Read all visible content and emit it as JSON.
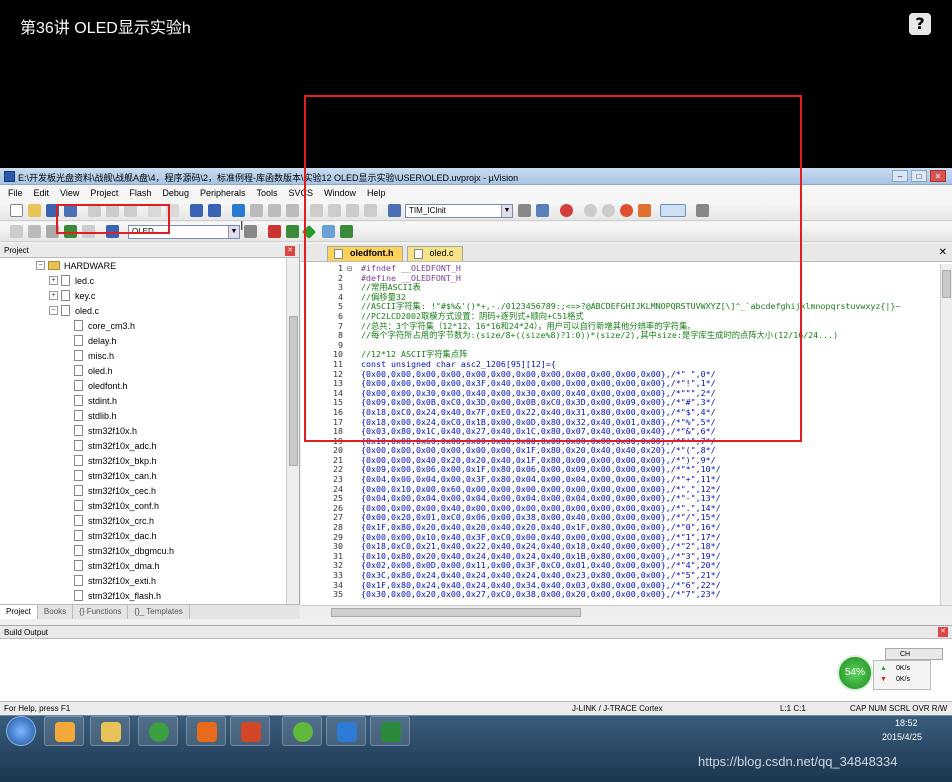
{
  "video": {
    "title": "第36讲 OLED显示实验h",
    "help_icon": "question-icon"
  },
  "window": {
    "title": "E:\\开发板光盘资料\\战舰\\战舰A盘\\4，程序源码\\2，标准例程-库函数版本\\实验12 OLED显示实验\\USER\\OLED.uvprojx - µVision"
  },
  "menu": [
    "File",
    "Edit",
    "View",
    "Project",
    "Flash",
    "Debug",
    "Peripherals",
    "Tools",
    "SVCS",
    "Window",
    "Help"
  ],
  "toolbar": {
    "function_combo": "TIM_ICInit",
    "target_combo": "OLED"
  },
  "project_panel": {
    "title": "Project",
    "tree": [
      {
        "label": "HARDWARE",
        "level": 0,
        "kind": "folder",
        "exp": "−"
      },
      {
        "label": "led.c",
        "level": 1,
        "kind": "file",
        "exp": "+"
      },
      {
        "label": "key.c",
        "level": 1,
        "kind": "file",
        "exp": "+"
      },
      {
        "label": "oled.c",
        "level": 1,
        "kind": "file",
        "exp": "−"
      },
      {
        "label": "core_cm3.h",
        "level": 2,
        "kind": "file"
      },
      {
        "label": "delay.h",
        "level": 2,
        "kind": "file"
      },
      {
        "label": "misc.h",
        "level": 2,
        "kind": "file"
      },
      {
        "label": "oled.h",
        "level": 2,
        "kind": "file"
      },
      {
        "label": "oledfont.h",
        "level": 2,
        "kind": "file"
      },
      {
        "label": "stdint.h",
        "level": 2,
        "kind": "file"
      },
      {
        "label": "stdlib.h",
        "level": 2,
        "kind": "file"
      },
      {
        "label": "stm32f10x.h",
        "level": 2,
        "kind": "file"
      },
      {
        "label": "stm32f10x_adc.h",
        "level": 2,
        "kind": "file"
      },
      {
        "label": "stm32f10x_bkp.h",
        "level": 2,
        "kind": "file"
      },
      {
        "label": "stm32f10x_can.h",
        "level": 2,
        "kind": "file"
      },
      {
        "label": "stm32f10x_cec.h",
        "level": 2,
        "kind": "file"
      },
      {
        "label": "stm32f10x_conf.h",
        "level": 2,
        "kind": "file"
      },
      {
        "label": "stm32f10x_crc.h",
        "level": 2,
        "kind": "file"
      },
      {
        "label": "stm32f10x_dac.h",
        "level": 2,
        "kind": "file"
      },
      {
        "label": "stm32f10x_dbgmcu.h",
        "level": 2,
        "kind": "file"
      },
      {
        "label": "stm32f10x_dma.h",
        "level": 2,
        "kind": "file"
      },
      {
        "label": "stm32f10x_exti.h",
        "level": 2,
        "kind": "file"
      },
      {
        "label": "stm32f10x_flash.h",
        "level": 2,
        "kind": "file"
      }
    ],
    "tabs": [
      "Project",
      "Books",
      "{} Functions",
      "{}_ Templates"
    ]
  },
  "editor": {
    "tabs": [
      "oledfont.h",
      "oled.c"
    ],
    "lines": [
      [
        "1",
        "⊟",
        "#ifndef __OLEDFONT_H",
        "pp"
      ],
      [
        "2",
        "",
        "#define __OLEDFONT_H",
        "pp"
      ],
      [
        "3",
        "",
        "//常用ASCII表",
        "cm"
      ],
      [
        "4",
        "",
        "//偏移量32",
        "cm"
      ],
      [
        "5",
        "",
        "//ASCII字符集: !\"#$%&'()*+,-./0123456789:;<=>?@ABCDEFGHIJKLMNOPQRSTUVWXYZ[\\]^_`abcdefghijklmnopqrstuvwxyz{|}~",
        "cm"
      ],
      [
        "6",
        "",
        "//PC2LCD2002取模方式设置：阴码+逐列式+顺向+C51格式",
        "cm"
      ],
      [
        "7",
        "",
        "//总共：3个字符集（12*12、16*16和24*24），用户可以自行新增其他分辨率的字符集。",
        "cm"
      ],
      [
        "8",
        "",
        "//每个字符所占用的字节数为:(size/8+((size%8)?1:0))*(size/2),其中size:是字库生成时的点阵大小(12/16/24...)",
        "cm"
      ],
      [
        "9",
        "",
        "",
        ""
      ],
      [
        "10",
        "",
        "//12*12 ASCII字符集点阵",
        "cm"
      ],
      [
        "11",
        "",
        "const unsigned char asc2_1206[95][12]={",
        "kw"
      ],
      [
        "12",
        "",
        "{0x00,0x00,0x00,0x00,0x00,0x00,0x00,0x00,0x00,0x00,0x00,0x00},/*\" \",0*/",
        "hx"
      ],
      [
        "13",
        "",
        "{0x00,0x00,0x00,0x00,0x3F,0x40,0x00,0x00,0x00,0x00,0x00,0x00},/*\"!\",1*/",
        "hx"
      ],
      [
        "14",
        "",
        "{0x00,0x00,0x30,0x00,0x40,0x00,0x30,0x00,0x40,0x00,0x00,0x00},/*\"\"\",2*/",
        "hx"
      ],
      [
        "15",
        "",
        "{0x09,0x00,0x0B,0xC0,0x3D,0x00,0x0B,0xC0,0x3D,0x00,0x09,0x00},/*\"#\",3*/",
        "hx"
      ],
      [
        "16",
        "",
        "{0x18,0xC0,0x24,0x40,0x7F,0xE0,0x22,0x40,0x31,0x80,0x00,0x00},/*\"$\",4*/",
        "hx"
      ],
      [
        "17",
        "",
        "{0x18,0x00,0x24,0xC0,0x1B,0x00,0x0D,0x80,0x32,0x40,0x01,0x80},/*\"%\",5*/",
        "hx"
      ],
      [
        "18",
        "",
        "{0x03,0x80,0x1C,0x40,0x27,0x40,0x1C,0x80,0x07,0x40,0x00,0x40},/*\"&\",6*/",
        "hx"
      ],
      [
        "19",
        "",
        "{0x10,0x00,0x60,0x00,0x00,0x00,0x00,0x00,0x00,0x00,0x00,0x00},/*\"'\",7*/",
        "hx"
      ],
      [
        "20",
        "",
        "{0x00,0x00,0x00,0x00,0x00,0x00,0x1F,0x80,0x20,0x40,0x40,0x20},/*\"(\",8*/",
        "hx"
      ],
      [
        "21",
        "",
        "{0x00,0x00,0x40,0x20,0x20,0x40,0x1F,0x80,0x00,0x00,0x00,0x00},/*\")\",9*/",
        "hx"
      ],
      [
        "22",
        "",
        "{0x09,0x00,0x06,0x00,0x1F,0x80,0x06,0x00,0x09,0x00,0x00,0x00},/*\"*\",10*/",
        "hx"
      ],
      [
        "23",
        "",
        "{0x04,0x00,0x04,0x00,0x3F,0x80,0x04,0x00,0x04,0x00,0x00,0x00},/*\"+\",11*/",
        "hx"
      ],
      [
        "24",
        "",
        "{0x00,0x10,0x00,0x60,0x00,0x00,0x00,0x00,0x00,0x00,0x00,0x00},/*\",\",12*/",
        "hx"
      ],
      [
        "25",
        "",
        "{0x04,0x00,0x04,0x00,0x04,0x00,0x04,0x00,0x04,0x00,0x00,0x00},/*\"-\",13*/",
        "hx"
      ],
      [
        "26",
        "",
        "{0x00,0x00,0x00,0x40,0x00,0x00,0x00,0x00,0x00,0x00,0x00,0x00},/*\".\",14*/",
        "hx"
      ],
      [
        "27",
        "",
        "{0x00,0x20,0x01,0xC0,0x06,0x00,0x38,0x00,0x40,0x00,0x00,0x00},/*\"/\",15*/",
        "hx"
      ],
      [
        "28",
        "",
        "{0x1F,0x80,0x20,0x40,0x20,0x40,0x20,0x40,0x1F,0x80,0x00,0x00},/*\"0\",16*/",
        "hx"
      ],
      [
        "29",
        "",
        "{0x00,0x00,0x10,0x40,0x3F,0xC0,0x00,0x40,0x00,0x00,0x00,0x00},/*\"1\",17*/",
        "hx"
      ],
      [
        "30",
        "",
        "{0x18,0xC0,0x21,0x40,0x22,0x40,0x24,0x40,0x18,0x40,0x00,0x00},/*\"2\",18*/",
        "hx"
      ],
      [
        "31",
        "",
        "{0x10,0x80,0x20,0x40,0x24,0x40,0x24,0x40,0x1B,0x80,0x00,0x00},/*\"3\",19*/",
        "hx"
      ],
      [
        "32",
        "",
        "{0x02,0x00,0x0D,0x00,0x11,0x00,0x3F,0xC0,0x01,0x40,0x00,0x00},/*\"4\",20*/",
        "hx"
      ],
      [
        "33",
        "",
        "{0x3C,0x80,0x24,0x40,0x24,0x40,0x24,0x40,0x23,0x80,0x00,0x00},/*\"5\",21*/",
        "hx"
      ],
      [
        "34",
        "",
        "{0x1F,0x80,0x24,0x40,0x24,0x40,0x34,0x40,0x03,0x80,0x00,0x00},/*\"6\",22*/",
        "hx"
      ],
      [
        "35",
        "",
        "{0x30,0x00,0x20,0x00,0x27,0xC0,0x38,0x00,0x20,0x00,0x00,0x00},/*\"7\",23*/",
        "hx"
      ]
    ]
  },
  "build_output": {
    "title": "Build Output"
  },
  "statusbar": {
    "help": "For Help, press F1",
    "debugger": "J-LINK / J-TRACE Cortex",
    "position": "L:1 C:1",
    "flags": "CAP  NUM  SCRL  OVR  R/W"
  },
  "overlay": {
    "gauge": "54%",
    "ime": "CH",
    "up": "0K/s",
    "down": "0K/s"
  },
  "taskbar": {
    "time": "18:52",
    "date": "2015/4/25"
  },
  "watermark": "https://blog.csdn.net/qq_34848334",
  "colors": {
    "highlight": "#e02020",
    "tab_active": "#ffd35a",
    "taskbar": "#1b3650"
  }
}
